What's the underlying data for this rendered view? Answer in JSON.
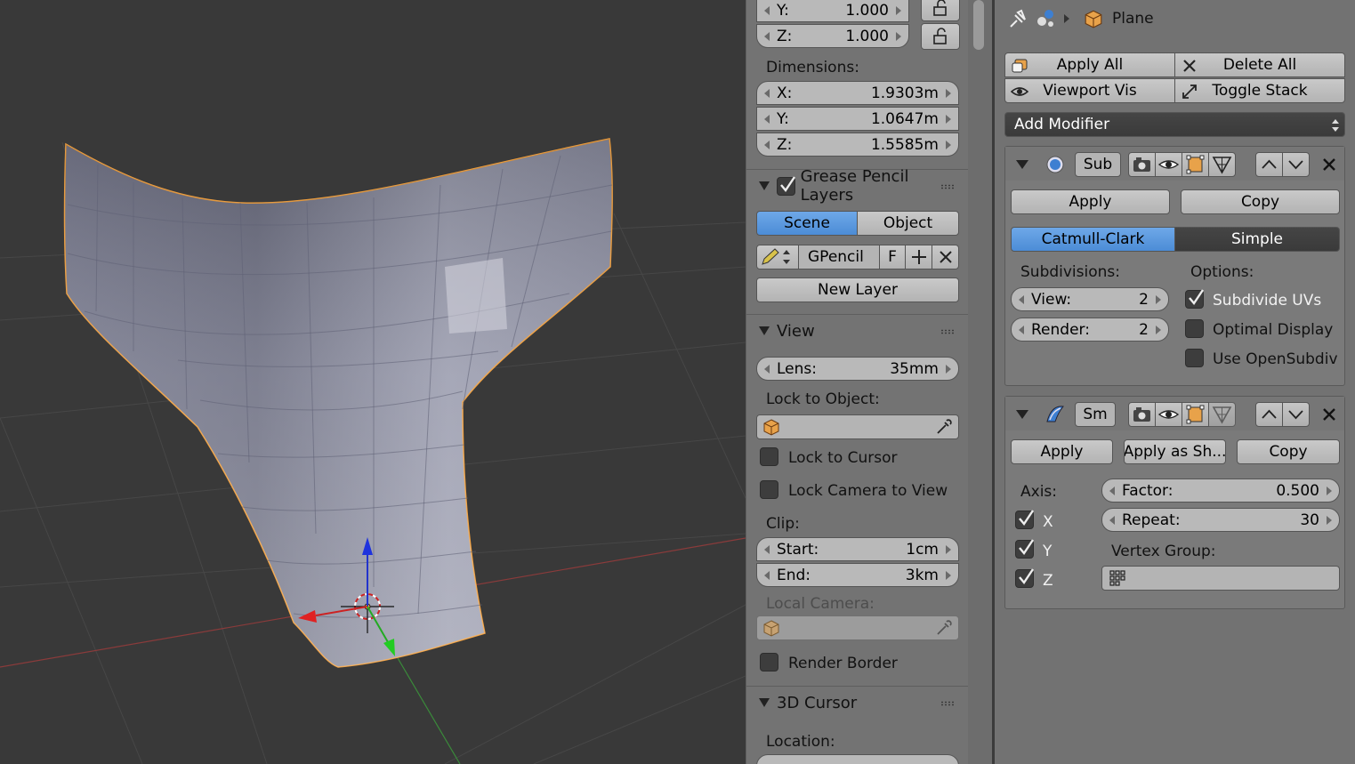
{
  "npanel": {
    "scale": {
      "y_label": "Y:",
      "y_value": "1.000",
      "z_label": "Z:",
      "z_value": "1.000"
    },
    "dimensions": {
      "label": "Dimensions:",
      "x_label": "X:",
      "x_value": "1.9303m",
      "y_label": "Y:",
      "y_value": "1.0647m",
      "z_label": "Z:",
      "z_value": "1.5585m"
    },
    "grease_pencil": {
      "title": "Grease Pencil Layers",
      "scene_tab": "Scene",
      "object_tab": "Object",
      "gpencil_name": "GPencil",
      "fake_user": "F",
      "new_layer": "New Layer"
    },
    "view": {
      "title": "View",
      "lens_label": "Lens:",
      "lens_value": "35mm",
      "lock_to_object": "Lock to Object:",
      "lock_to_cursor": "Lock to Cursor",
      "lock_camera_to_view": "Lock Camera to View",
      "clip": "Clip:",
      "start_label": "Start:",
      "start_value": "1cm",
      "end_label": "End:",
      "end_value": "3km",
      "local_camera": "Local Camera:",
      "render_border": "Render Border"
    },
    "cursor": {
      "title": "3D Cursor",
      "location": "Location:"
    }
  },
  "modifiers": {
    "context": {
      "object_name": "Plane"
    },
    "apply_all": "Apply All",
    "delete_all": "Delete All",
    "viewport_vis": "Viewport Vis",
    "toggle_stack": "Toggle Stack",
    "add_modifier": "Add Modifier",
    "subsurf": {
      "name": "Sub",
      "apply": "Apply",
      "copy": "Copy",
      "catmull_clark": "Catmull-Clark",
      "simple": "Simple",
      "subdivisions_label": "Subdivisions:",
      "options_label": "Options:",
      "view_label": "View:",
      "view_value": "2",
      "render_label": "Render:",
      "render_value": "2",
      "subdivide_uvs": "Subdivide UVs",
      "optimal_display": "Optimal Display",
      "use_opensubdiv": "Use OpenSubdiv"
    },
    "smooth": {
      "name": "Sm",
      "apply": "Apply",
      "apply_as_shape": "Apply as Sh...",
      "copy": "Copy",
      "axis_label": "Axis:",
      "x": "X",
      "y": "Y",
      "z": "Z",
      "factor_label": "Factor:",
      "factor_value": "0.500",
      "repeat_label": "Repeat:",
      "repeat_value": "30",
      "vertex_group_label": "Vertex Group:"
    }
  },
  "colors": {
    "accent_blue": "#5a96de",
    "selection_orange": "#f0a040",
    "viewport_bg": "#393939"
  }
}
